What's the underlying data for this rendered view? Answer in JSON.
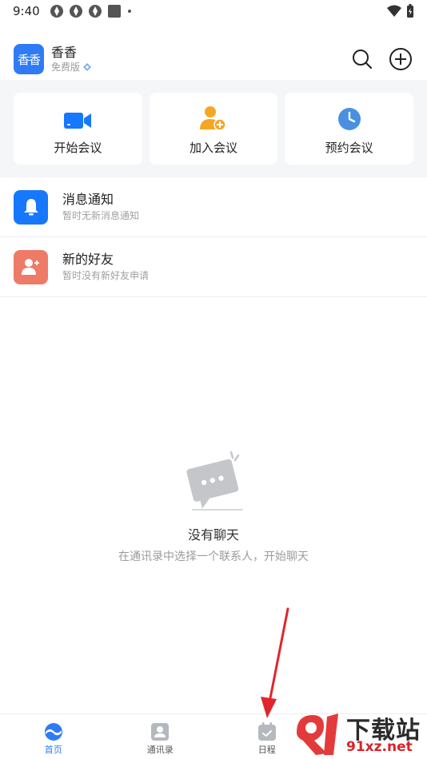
{
  "status": {
    "time": "9:40"
  },
  "header": {
    "avatar_text": "香香",
    "user_name": "香香",
    "plan": "免费版"
  },
  "actions": [
    {
      "label": "开始会议",
      "icon": "video-camera-icon",
      "color": "#1677ff"
    },
    {
      "label": "加入会议",
      "icon": "person-add-icon",
      "color": "#f5a623"
    },
    {
      "label": "预约会议",
      "icon": "clock-icon",
      "color": "#4a90e2"
    }
  ],
  "list": [
    {
      "title": "消息通知",
      "subtitle": "暂时无新消息通知",
      "icon": "bell-icon",
      "color": "#1677ff"
    },
    {
      "title": "新的好友",
      "subtitle": "暂时没有新好友申请",
      "icon": "person-add-icon",
      "color": "#ee7a68"
    }
  ],
  "empty": {
    "title": "没有聊天",
    "subtitle": "在通讯录中选择一个联系人，开始聊天"
  },
  "nav": [
    {
      "label": "首页",
      "icon": "home-logo-icon",
      "active": true
    },
    {
      "label": "通讯录",
      "icon": "contacts-icon",
      "active": false
    },
    {
      "label": "日程",
      "icon": "calendar-icon",
      "active": false
    }
  ],
  "watermark": {
    "title": "下载站",
    "url": "91xz.net"
  },
  "colors": {
    "accent": "#2f7bf6",
    "background_gray": "#f5f6f8"
  }
}
